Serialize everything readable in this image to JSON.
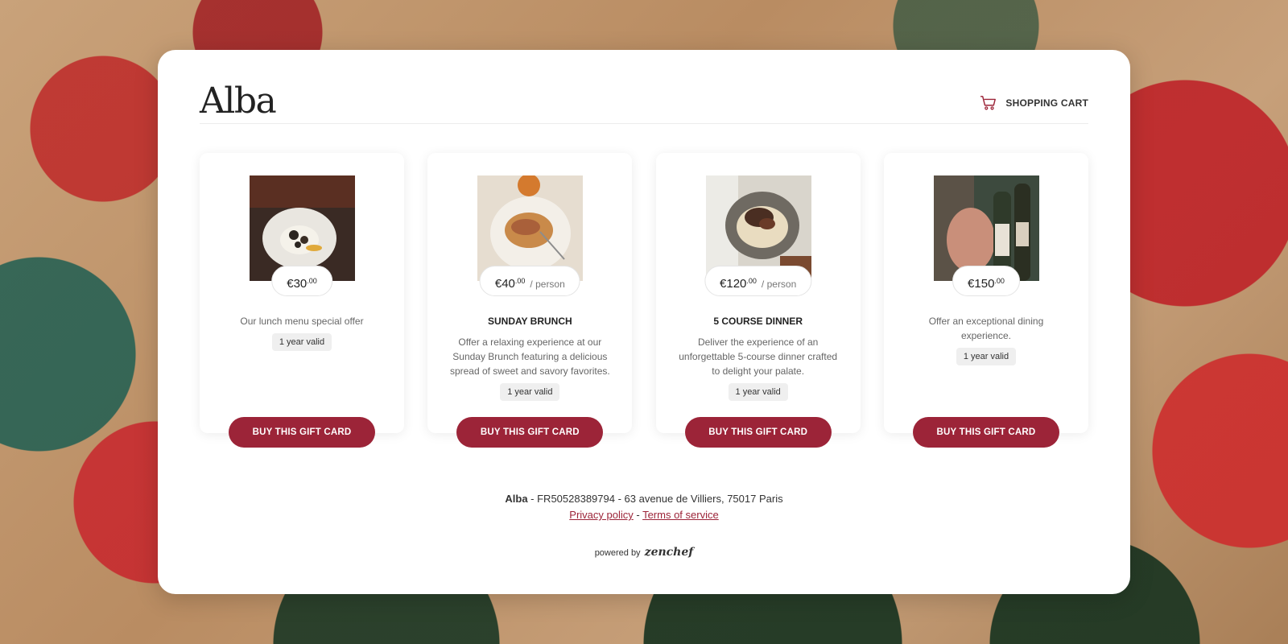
{
  "header": {
    "logo": "Alba",
    "cart_label": "SHOPPING CART"
  },
  "offers": [
    {
      "price_main": "€30",
      "price_cents": ".00",
      "price_per": "",
      "title": "",
      "description": "Our lunch menu special offer",
      "validity": "1 year valid",
      "button": "BUY THIS GIFT CARD",
      "photo": "lunch-dish-photo"
    },
    {
      "price_main": "€40",
      "price_cents": ".00",
      "price_per": "/ person",
      "title": "SUNDAY BRUNCH",
      "description": "Offer a relaxing experience at our Sunday Brunch featuring a delicious spread of sweet and savory favorites.",
      "validity": "1 year valid",
      "button": "BUY THIS GIFT CARD",
      "photo": "brunch-dish-photo"
    },
    {
      "price_main": "€120",
      "price_cents": ".00",
      "price_per": "/ person",
      "title": "5 COURSE DINNER",
      "description": "Deliver the experience of an unforgettable 5-course dinner crafted to delight your palate.",
      "validity": "1 year valid",
      "button": "BUY THIS GIFT CARD",
      "photo": "dinner-dish-photo"
    },
    {
      "price_main": "€150",
      "price_cents": ".00",
      "price_per": "",
      "title": "",
      "description": "Offer an exceptional dining experience.",
      "validity": "1 year valid",
      "button": "BUY THIS GIFT CARD",
      "photo": "wine-bottle-photo"
    }
  ],
  "footer": {
    "name": "Alba",
    "info": " - FR50528389794 - 63 avenue de Villiers, 75017 Paris",
    "privacy": "Privacy policy",
    "separator": " - ",
    "terms": "Terms of service",
    "powered_by": "powered by",
    "brand": "zenchef"
  },
  "colors": {
    "accent": "#9c2438"
  }
}
